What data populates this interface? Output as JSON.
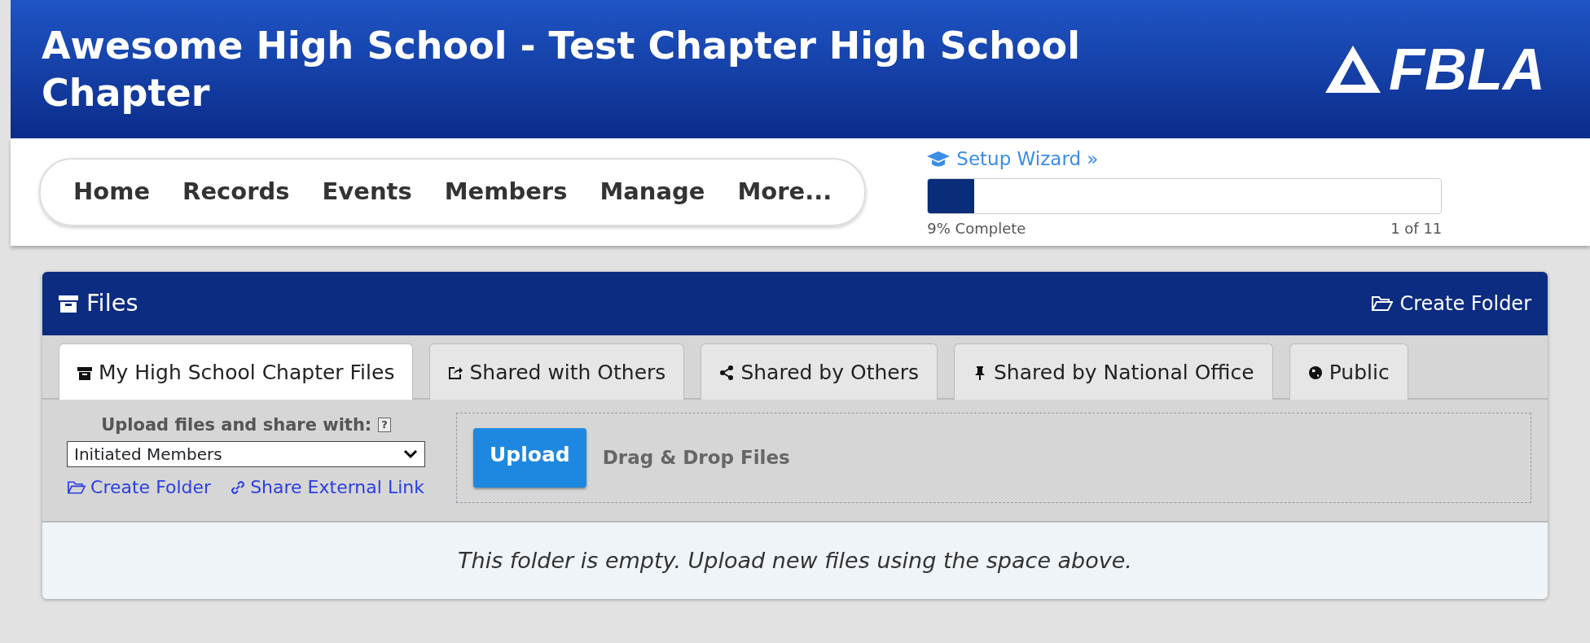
{
  "header": {
    "title": "Awesome High School - Test Chapter High School Chapter",
    "logo_text": "FBLA"
  },
  "nav": {
    "items": [
      {
        "label": "Home"
      },
      {
        "label": "Records"
      },
      {
        "label": "Events"
      },
      {
        "label": "Members"
      },
      {
        "label": "Manage"
      },
      {
        "label": "More..."
      }
    ]
  },
  "setup_wizard": {
    "link": "Setup Wizard »",
    "level": 0.09,
    "percent_text": "9% Complete",
    "step_text": "1 of 11"
  },
  "files_panel": {
    "title": "Files",
    "header_action": "Create Folder",
    "tabs": [
      {
        "label": "My High School Chapter Files",
        "selected": true
      },
      {
        "label": "Shared with Others",
        "selected": false
      },
      {
        "label": "Shared by Others",
        "selected": false
      },
      {
        "label": "Shared by National Office",
        "selected": false
      },
      {
        "label": "Public",
        "selected": false
      }
    ],
    "upload": {
      "share_label": "Upload files and share with:",
      "help": "?",
      "share_value": "Initiated Members",
      "create_folder": "Create Folder",
      "share_link": "Share External Link",
      "button": "Upload",
      "drop_text": "Drag & Drop Files"
    },
    "empty_message": "This folder is empty. Upload new files using the space above."
  }
}
